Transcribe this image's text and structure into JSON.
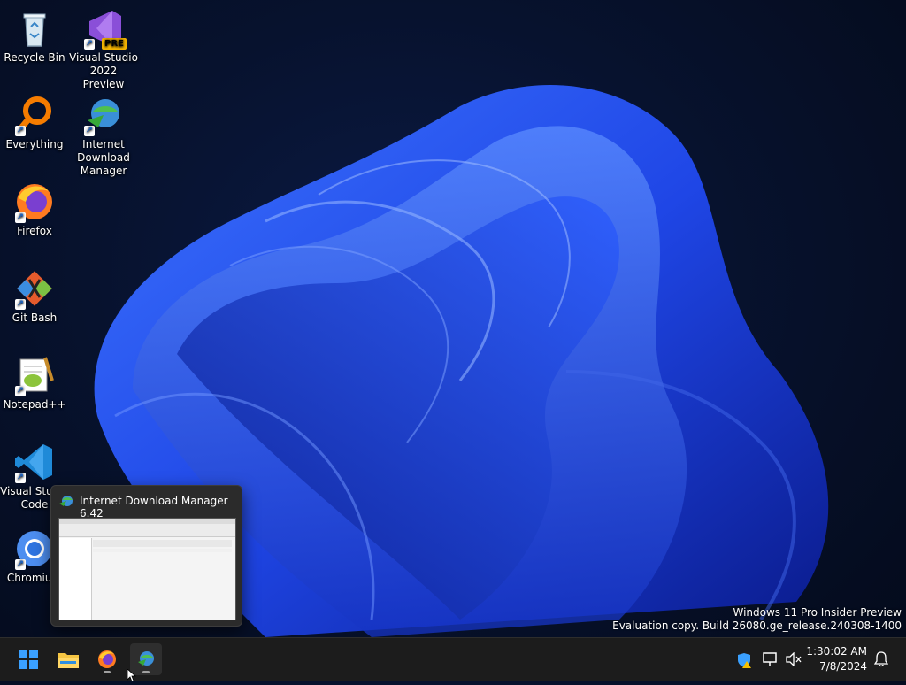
{
  "desktop": {
    "icons": [
      {
        "label": "Recycle Bin",
        "icon": "recycle-bin-icon"
      },
      {
        "label": "Visual Studio 2022 Preview",
        "icon": "visual-studio-preview-icon",
        "badge": "PRE"
      },
      {
        "label": "Everything",
        "icon": "everything-search-icon"
      },
      {
        "label": "Internet Download Manager",
        "icon": "idm-icon"
      },
      {
        "label": "Firefox",
        "icon": "firefox-icon"
      },
      {
        "label": "Git Bash",
        "icon": "git-bash-icon"
      },
      {
        "label": "Notepad++",
        "icon": "notepad-plus-plus-icon"
      },
      {
        "label": "Visual Studio Code",
        "icon": "vscode-icon"
      },
      {
        "label": "Chromium",
        "icon": "chromium-icon"
      }
    ]
  },
  "thumbnail": {
    "title": "Internet Download Manager 6.42"
  },
  "watermark": {
    "line1": "Windows 11 Pro Insider Preview",
    "line2": "Evaluation copy. Build 26080.ge_release.240308-1400"
  },
  "taskbar": {
    "apps": [
      {
        "name": "Start",
        "icon": "windows-start-icon"
      },
      {
        "name": "File Explorer",
        "icon": "file-explorer-icon"
      },
      {
        "name": "Firefox",
        "icon": "firefox-icon"
      },
      {
        "name": "Internet Download Manager",
        "icon": "idm-icon"
      }
    ],
    "tray": {
      "time": "1:30:02 AM",
      "date": "7/8/2024"
    }
  },
  "colors": {
    "accent": "#1f4fff",
    "taskbar": "#1c1c1c"
  }
}
